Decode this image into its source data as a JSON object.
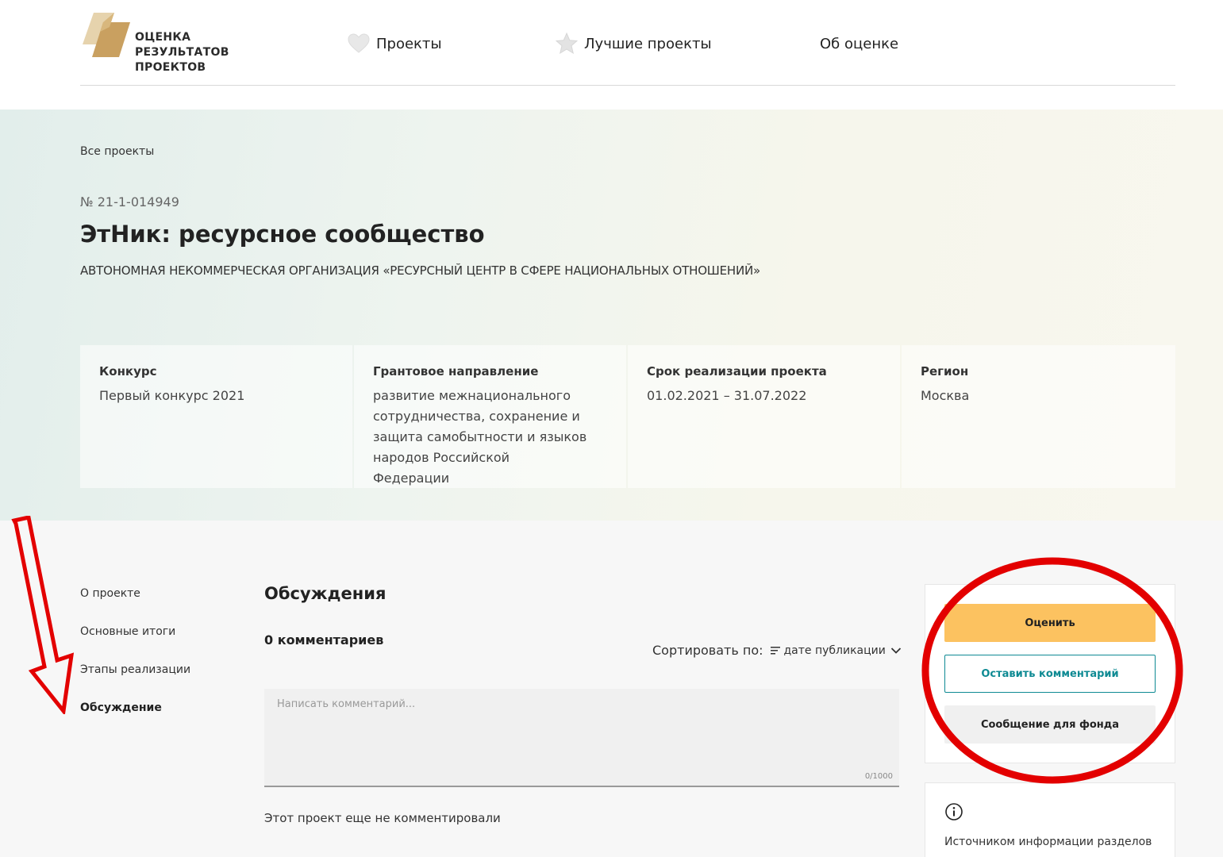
{
  "logo": {
    "lines": [
      "ОЦЕНКА",
      "РЕЗУЛЬТАТОВ",
      "ПРОЕКТОВ"
    ],
    "colors": {
      "light": "#e3cfa6",
      "dark": "#c89f5c"
    }
  },
  "nav": {
    "projects": {
      "label": "Проекты",
      "icon": "heart-icon"
    },
    "best": {
      "label": "Лучшие проекты",
      "icon": "star-icon"
    },
    "about": {
      "label": "Об оценке"
    }
  },
  "hero": {
    "breadcrumb": "Все проекты",
    "number": "№ 21-1-014949",
    "title": "ЭтНик: ресурсное сообщество",
    "organization": "АВТОНОМНАЯ НЕКОММЕРЧЕСКАЯ ОРГАНИЗАЦИЯ «РЕСУРСНЫЙ ЦЕНТР В СФЕРЕ НАЦИОНАЛЬНЫХ ОТНОШЕНИЙ»",
    "info": [
      {
        "label": "Конкурс",
        "value": "Первый конкурс 2021"
      },
      {
        "label": "Грантовое направление",
        "value": "развитие межнационального сотрудничества, сохранение и защита самобытности и языков народов Российской Федерации"
      },
      {
        "label": "Срок реализации проекта",
        "value": "01.02.2021 – 31.07.2022"
      },
      {
        "label": "Регион",
        "value": "Москва"
      }
    ]
  },
  "sidebar": {
    "items": [
      {
        "label": "О проекте"
      },
      {
        "label": "Основные итоги"
      },
      {
        "label": "Этапы реализации"
      },
      {
        "label": "Обсуждение",
        "active": true
      }
    ]
  },
  "discussion": {
    "title": "Обсуждения",
    "count": "0 комментариев",
    "sort_label": "Сортировать по:",
    "sort_value": "дате публикации",
    "input_placeholder": "Написать комментарий...",
    "char_count": "0/1000",
    "empty_text": "Этот проект еще не комментировали"
  },
  "actions": {
    "rate": "Оценить",
    "comment": "Оставить комментарий",
    "fund_message": "Сообщение для фонда"
  },
  "info_panel": {
    "icon": "info-icon",
    "text": "Источником информации разделов"
  },
  "colors": {
    "accent_teal": "#0e8a93",
    "rate_yellow": "#fcc260",
    "annotation_red": "#e30000"
  }
}
